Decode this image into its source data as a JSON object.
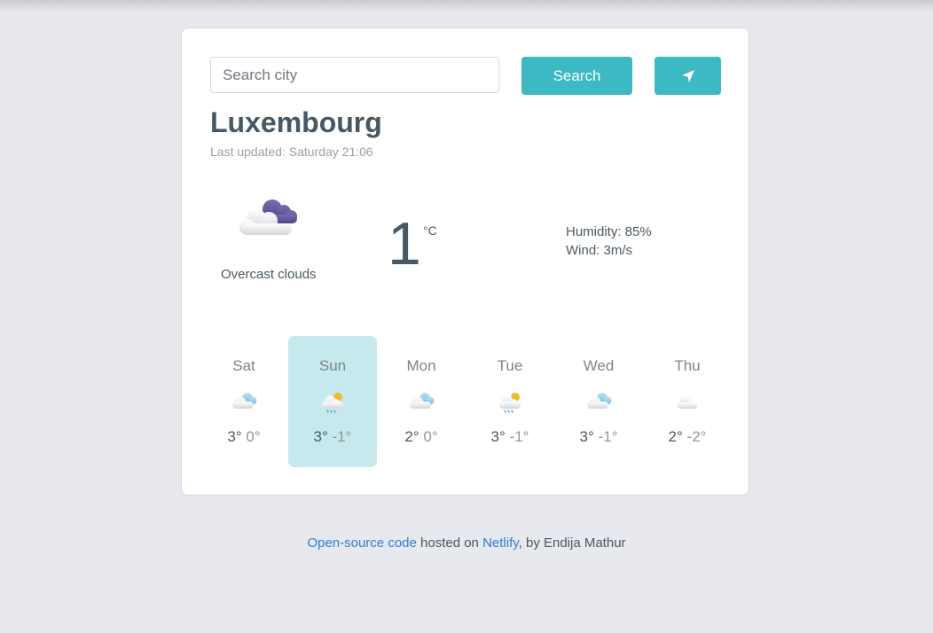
{
  "search": {
    "placeholder": "Search city",
    "button_label": "Search"
  },
  "locate_button": {
    "icon": "location-arrow-icon"
  },
  "current": {
    "city": "Luxembourg",
    "last_updated": "Last updated: Saturday 21:06",
    "icon": "overcast-clouds-icon",
    "description": "Overcast clouds",
    "temperature": "1",
    "unit": "°C",
    "humidity": "Humidity: 85%",
    "wind": "Wind: 3m/s"
  },
  "forecast": [
    {
      "day": "Sat",
      "max": "3°",
      "min": "0°",
      "icon": "light-rain-cloud-icon",
      "active": false
    },
    {
      "day": "Sun",
      "max": "3°",
      "min": "-1°",
      "icon": "sun-cloud-rain-icon",
      "active": true
    },
    {
      "day": "Mon",
      "max": "2°",
      "min": "0°",
      "icon": "light-rain-cloud-icon",
      "active": false
    },
    {
      "day": "Tue",
      "max": "3°",
      "min": "-1°",
      "icon": "sun-cloud-rain-icon",
      "active": false
    },
    {
      "day": "Wed",
      "max": "3°",
      "min": "-1°",
      "icon": "light-rain-cloud-icon",
      "active": false
    },
    {
      "day": "Thu",
      "max": "2°",
      "min": "-2°",
      "icon": "cloud-icon",
      "active": false
    }
  ],
  "footer": {
    "link1": "Open-source code",
    "text1": " hosted on ",
    "link2": "Netlify",
    "text2": ", by Endija Mathur"
  },
  "colors": {
    "accent": "#3db9c3",
    "active_day": "#c5e9ed",
    "link": "#2c7fd4",
    "text": "#465865"
  }
}
